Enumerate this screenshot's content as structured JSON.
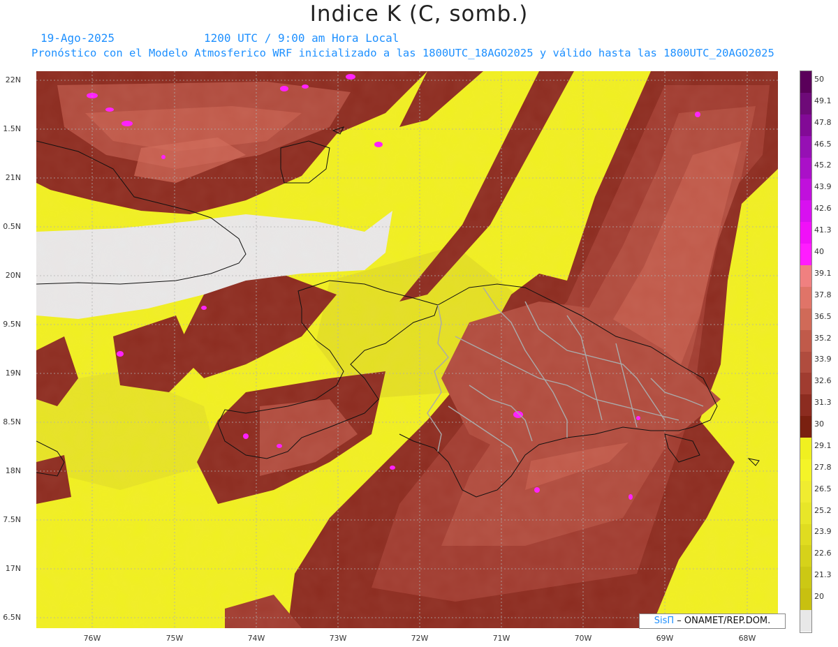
{
  "title": "Indice K (C, somb.)",
  "subtitle": {
    "date": "19-Ago-2025",
    "time": "1200 UTC / 9:00 am Hora Local",
    "model": "Pronóstico con el Modelo Atmosferico WRF inicializado a las 1800UTC_18AGO2025 y válido hasta las  1800UTC_20AGO2025"
  },
  "axes": {
    "lat_labels": [
      "22N",
      "1.5N",
      "21N",
      "0.5N",
      "20N",
      "9.5N",
      "19N",
      "8.5N",
      "18N",
      "7.5N",
      "17N",
      "6.5N"
    ],
    "lon_labels": [
      "76W",
      "75W",
      "74W",
      "73W",
      "72W",
      "71W",
      "70W",
      "69W",
      "68W"
    ]
  },
  "colorbar": {
    "labels": [
      "50",
      "49.1",
      "47.8",
      "46.5",
      "45.2",
      "43.9",
      "42.6",
      "41.3",
      "40",
      "39.1",
      "37.8",
      "36.5",
      "35.2",
      "33.9",
      "32.6",
      "31.3",
      "30",
      "29.1",
      "27.8",
      "26.5",
      "25.2",
      "23.9",
      "22.6",
      "21.3",
      "20"
    ],
    "colors": [
      "#5a005a",
      "#6e0a78",
      "#820a96",
      "#9610b4",
      "#aa10c8",
      "#c010dc",
      "#d810f0",
      "#f010f8",
      "#ff1cff",
      "#f08080",
      "#e07468",
      "#d06a58",
      "#c05a4a",
      "#b04c3e",
      "#a03c30",
      "#8c2c20",
      "#7a2010",
      "#f0f020",
      "#f4f428",
      "#f0ec30",
      "#e8e628",
      "#e0dc20",
      "#d6d21a",
      "#ccc814",
      "#c8c010",
      "#e8e8e8"
    ]
  },
  "credit": {
    "sis": "SisΠ",
    "org": "– ONAMET/REP.DOM."
  }
}
